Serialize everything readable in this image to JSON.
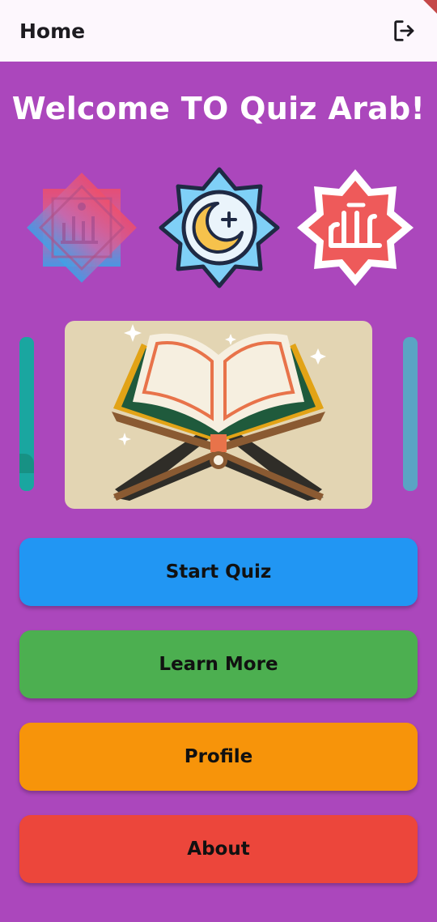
{
  "appbar": {
    "title": "Home",
    "logout_icon": "logout-icon"
  },
  "welcome": "Welcome TO Quiz Arab!",
  "icons": [
    "rub-el-hizb-star-icon",
    "crescent-moon-badge-icon",
    "allah-calligraphy-badge-icon"
  ],
  "carousel": {
    "current_image": "quran-on-stand-illustration"
  },
  "buttons": [
    {
      "label": "Start Quiz",
      "color": "#2196f3"
    },
    {
      "label": "Learn More",
      "color": "#4caf50"
    },
    {
      "label": "Profile",
      "color": "#f7940a"
    },
    {
      "label": "About",
      "color": "#ec463b"
    }
  ],
  "colors": {
    "background": "#ab47bc",
    "appbar": "#fdf7fd"
  }
}
